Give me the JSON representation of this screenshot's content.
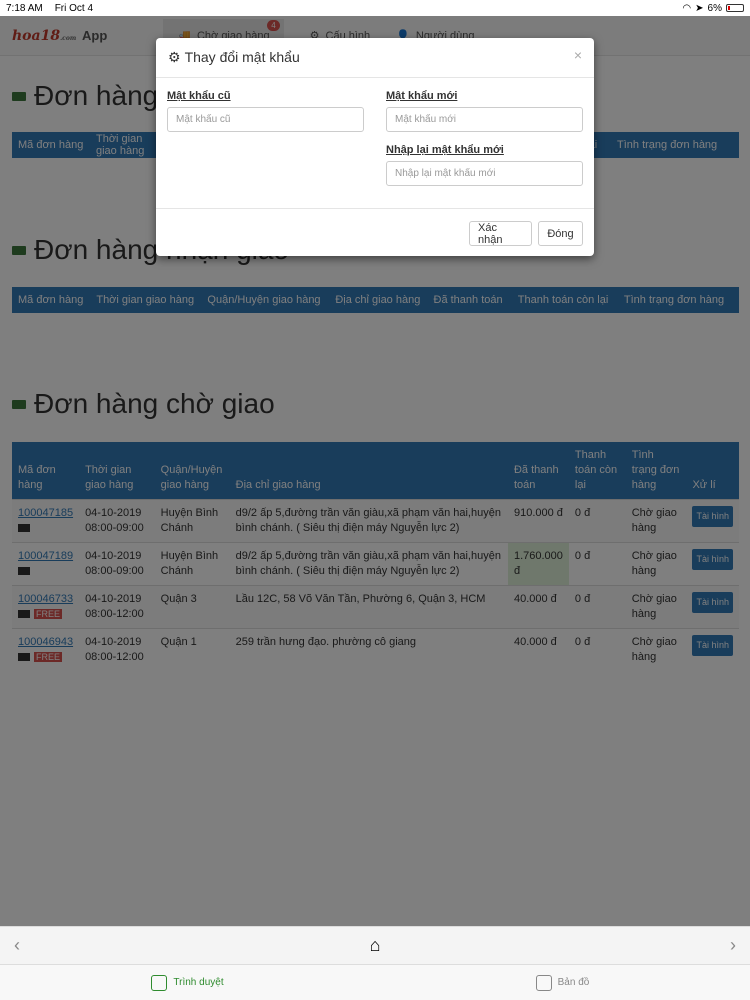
{
  "status_bar": {
    "time": "7:18 AM",
    "date": "Fri Oct 4",
    "battery": "6%"
  },
  "navbar": {
    "logo": "hoa18",
    "logo_suffix": ".com",
    "brand": "App",
    "items": [
      {
        "label": "Chờ giao hàng",
        "icon": "truck-icon",
        "badge": "4"
      },
      {
        "label": "Cấu hình",
        "icon": "gear-icon"
      },
      {
        "label": "Người dùng",
        "icon": "user-icon"
      }
    ]
  },
  "sections": {
    "section1_title": "Đơn hàng",
    "section2_title": "Đơn hàng nhận giao",
    "section3_title": "Đơn hàng chờ giao"
  },
  "table_headers": {
    "order_id": "Mã đơn hàng",
    "delivery_time": "Thời gian giao hàng",
    "district": "Quận/Huyện giao hàng",
    "address": "Địa chỉ giao hàng",
    "paid": "Đã thanh toán",
    "remaining": "Thanh toán còn lại",
    "status": "Tình trạng đơn hàng",
    "action": "Xử lí",
    "section1_visible_tail": "n lại"
  },
  "orders": [
    {
      "id": "100047185",
      "free": "",
      "date": "04-10-2019",
      "time": "08:00-09:00",
      "district": "Huyện Bình Chánh",
      "address": "d9/2 ấp 5,đường trần văn giàu,xã phạm văn hai,huyện bình chánh. ( Siêu thị điện máy Nguyễn lực 2)",
      "paid": "910.000 đ",
      "remaining": "0 đ",
      "status": "Chờ giao hàng",
      "action": "Tài hình"
    },
    {
      "id": "100047189",
      "free": "",
      "date": "04-10-2019",
      "time": "08:00-09:00",
      "district": "Huyện Bình Chánh",
      "address": "d9/2 ấp 5,đường trần văn giàu,xã phạm văn hai,huyện bình chánh. ( Siêu thị điện máy Nguyễn lực 2)",
      "paid": "1.760.000 đ",
      "remaining": "0 đ",
      "status": "Chờ giao hàng",
      "action": "Tài hình"
    },
    {
      "id": "100046733",
      "free": "FREE",
      "date": "04-10-2019",
      "time": "08:00-12:00",
      "district": "Quận 3",
      "address": "Lầu 12C, 58 Võ Văn Tần, Phường 6, Quận 3, HCM",
      "paid": "40.000 đ",
      "remaining": "0 đ",
      "status": "Chờ giao hàng",
      "action": "Tài hình"
    },
    {
      "id": "100046943",
      "free": "FREE",
      "date": "04-10-2019",
      "time": "08:00-12:00",
      "district": "Quận 1",
      "address": "259 trần hưng đạo. phường cô giang",
      "paid": "40.000 đ",
      "remaining": "0 đ",
      "status": "Chờ giao hàng",
      "action": "Tài hình"
    }
  ],
  "modal": {
    "title": "Thay đổi mật khẩu",
    "close": "×",
    "old_label": "Mật khẩu cũ",
    "old_placeholder": "Mật khẩu cũ",
    "new_label": "Mật khẩu mới",
    "new_placeholder": "Mật khẩu mới",
    "confirm_label": "Nhập lại mật khẩu mới",
    "confirm_placeholder": "Nhập lại mật khẩu mới",
    "submit": "Xác nhận",
    "cancel": "Đóng"
  },
  "toolbar": {
    "back": "‹",
    "home": "⌂",
    "forward": "›"
  },
  "tabbar": {
    "browser": "Trình duyệt",
    "map": "Bản đồ"
  },
  "colors": {
    "primary": "#337ab7",
    "badge": "#d9534f",
    "active_tab": "#2e8b2e",
    "paid_highlight": "#dff0d8"
  }
}
